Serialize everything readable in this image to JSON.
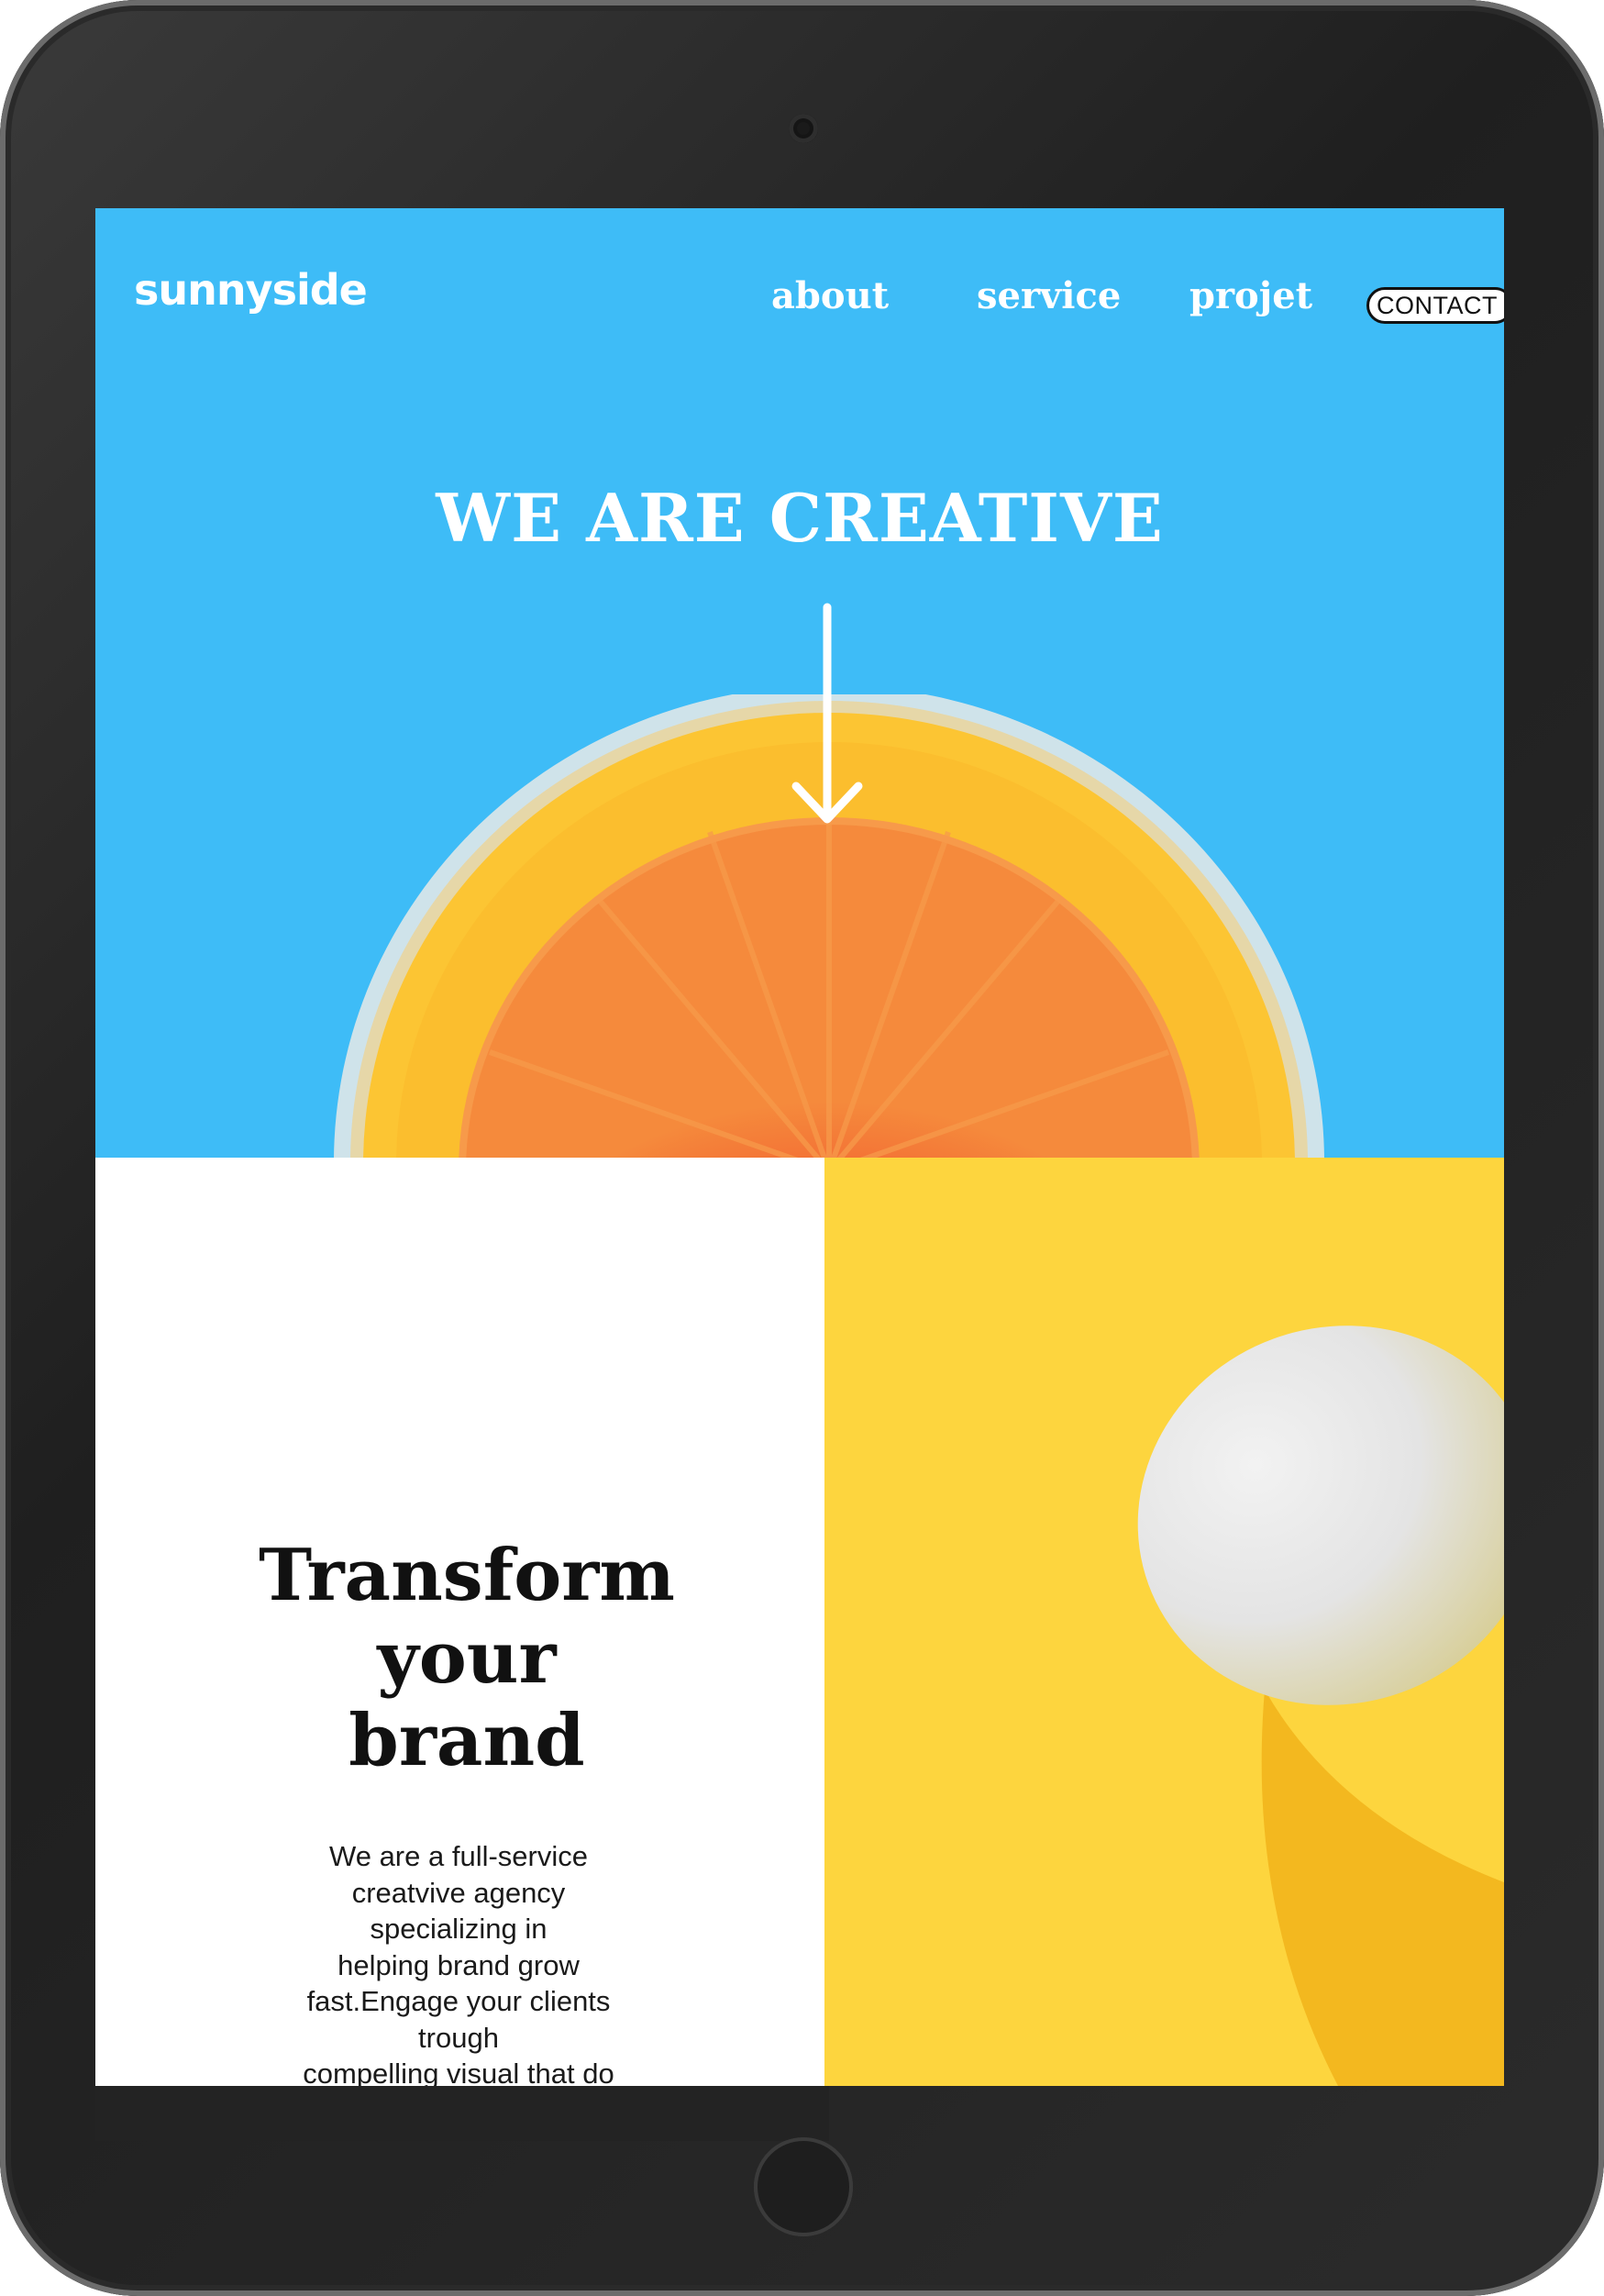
{
  "device": {
    "camera_icon": "camera-icon",
    "home_button_icon": "home-button-icon"
  },
  "header": {
    "logo": "sunnyside",
    "nav": {
      "about": "about",
      "service": "service",
      "projet": "projet",
      "contact": "CONTACT"
    }
  },
  "hero": {
    "title": "WE ARE CREATIVE",
    "arrow_icon": "arrow-down-icon",
    "background_color": "#3ebcf7"
  },
  "transform": {
    "title_lines": [
      "Transform",
      "your",
      "brand"
    ],
    "body_lines": [
      "We are a full-service",
      "creatvive agency",
      "specializing in",
      "helping brand grow",
      "fast.Engage your clients",
      "trough",
      "compelling visual that do"
    ]
  },
  "colors": {
    "hero_blue": "#3ebcf7",
    "panel_yellow": "#fdd53e",
    "orange": "#f26a2b"
  }
}
